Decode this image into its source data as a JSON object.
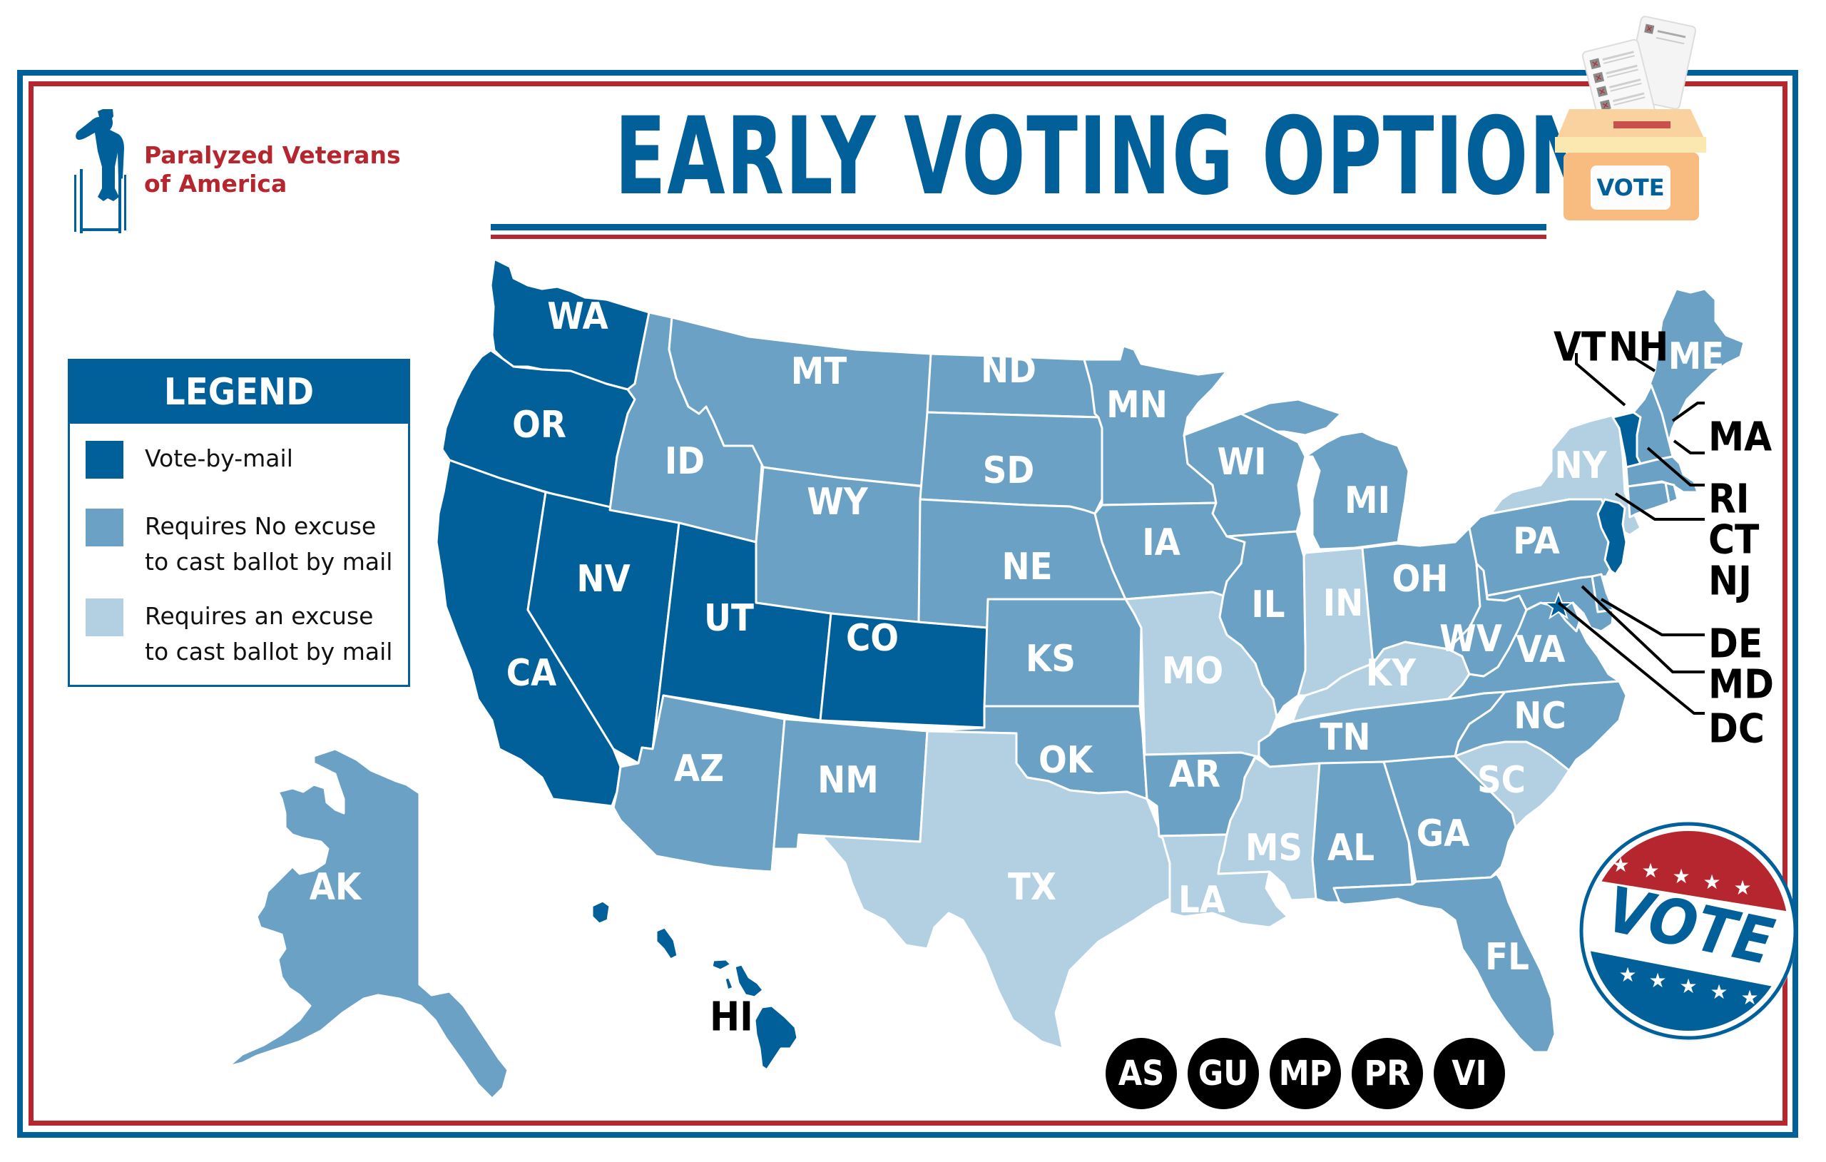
{
  "organization": {
    "name_line1": "Paralyzed Veterans",
    "name_line2": "of America"
  },
  "title": "EARLY VOTING OPTIONS",
  "ballot_box": {
    "label": "VOTE"
  },
  "badge": {
    "label": "VOTE"
  },
  "colors": {
    "vote_by_mail": "#01609a",
    "no_excuse": "#6aa1c4",
    "excuse_required": "#b3d0e3",
    "brand_blue": "#01609a",
    "brand_red": "#b5262f"
  },
  "legend": {
    "title": "LEGEND",
    "items": [
      {
        "category": "vote_by_mail",
        "label": "Vote-by-mail"
      },
      {
        "category": "no_excuse",
        "label": "Requires No excuse to cast ballot by mail"
      },
      {
        "category": "excuse_required",
        "label": "Requires an excuse to cast ballot by mail"
      }
    ]
  },
  "states": {
    "WA": "vote_by_mail",
    "OR": "vote_by_mail",
    "CA": "vote_by_mail",
    "NV": "vote_by_mail",
    "UT": "vote_by_mail",
    "CO": "vote_by_mail",
    "HI": "vote_by_mail",
    "VT": "vote_by_mail",
    "NJ": "vote_by_mail",
    "DC": "vote_by_mail",
    "ID": "no_excuse",
    "MT": "no_excuse",
    "WY": "no_excuse",
    "AZ": "no_excuse",
    "NM": "no_excuse",
    "ND": "no_excuse",
    "SD": "no_excuse",
    "NE": "no_excuse",
    "KS": "no_excuse",
    "OK": "no_excuse",
    "MN": "no_excuse",
    "IA": "no_excuse",
    "AR": "no_excuse",
    "WI": "no_excuse",
    "IL": "no_excuse",
    "MI": "no_excuse",
    "OH": "no_excuse",
    "PA": "no_excuse",
    "WV": "no_excuse",
    "VA": "no_excuse",
    "NC": "no_excuse",
    "TN": "no_excuse",
    "AL": "no_excuse",
    "GA": "no_excuse",
    "FL": "no_excuse",
    "ME": "no_excuse",
    "NH": "no_excuse",
    "MA": "no_excuse",
    "RI": "no_excuse",
    "CT": "no_excuse",
    "DE": "no_excuse",
    "MD": "no_excuse",
    "AK": "no_excuse",
    "TX": "excuse_required",
    "MO": "excuse_required",
    "LA": "excuse_required",
    "MS": "excuse_required",
    "IN": "excuse_required",
    "KY": "excuse_required",
    "SC": "excuse_required",
    "NY": "excuse_required"
  },
  "callouts": [
    "VT",
    "NH",
    "MA",
    "RI",
    "CT",
    "NJ",
    "DE",
    "MD",
    "DC",
    "HI"
  ],
  "territories": [
    "AS",
    "GU",
    "MP",
    "PR",
    "VI"
  ]
}
